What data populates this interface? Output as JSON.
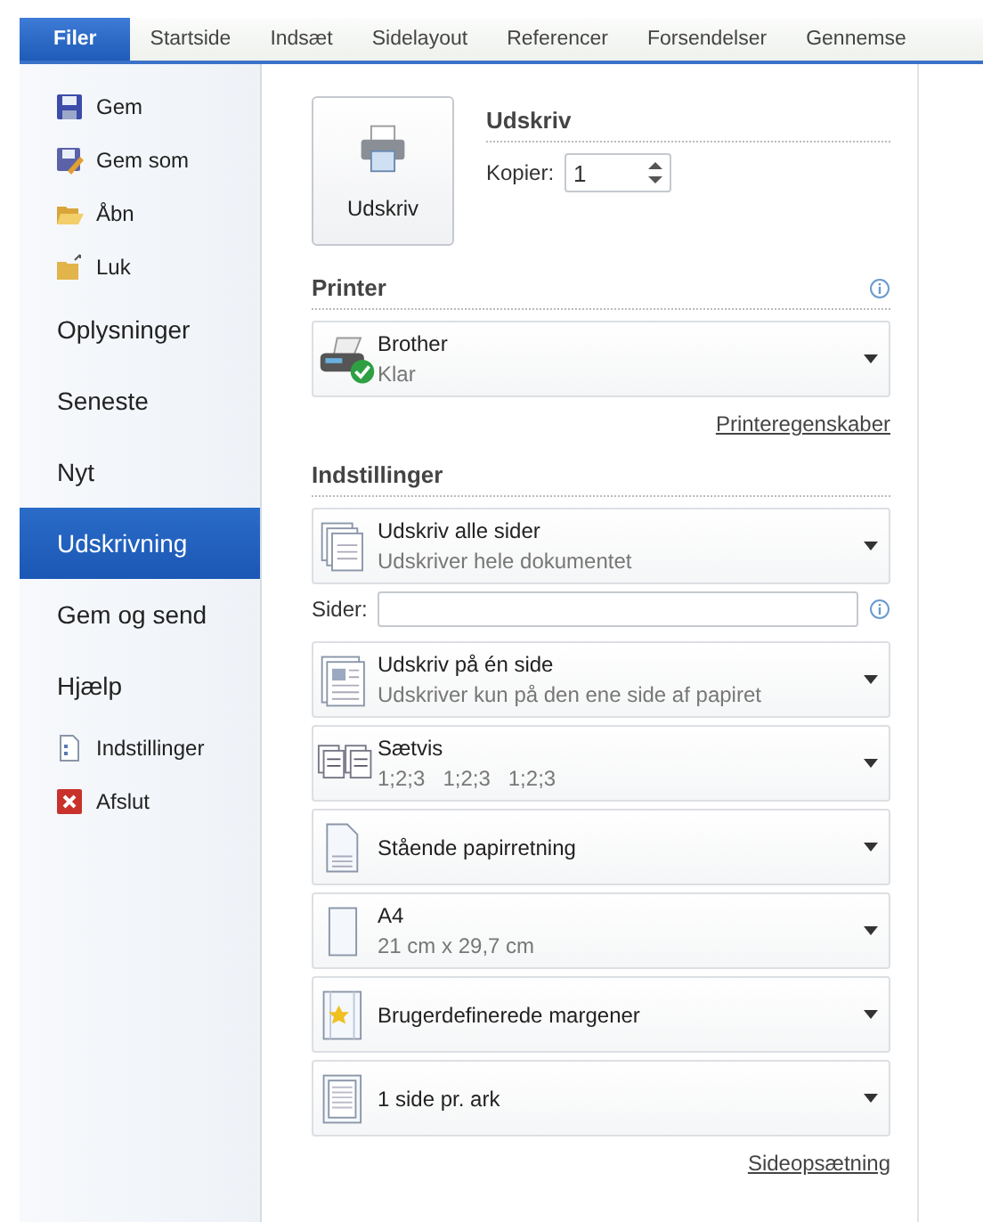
{
  "tabs": [
    {
      "label": "Filer",
      "selected": true
    },
    {
      "label": "Startside",
      "selected": false
    },
    {
      "label": "Indsæt",
      "selected": false
    },
    {
      "label": "Sidelayout",
      "selected": false
    },
    {
      "label": "Referencer",
      "selected": false
    },
    {
      "label": "Forsendelser",
      "selected": false
    },
    {
      "label": "Gennemse",
      "selected": false
    }
  ],
  "sidebar": {
    "items": [
      {
        "kind": "command",
        "label": "Gem",
        "selected": false
      },
      {
        "kind": "command",
        "label": "Gem som",
        "selected": false
      },
      {
        "kind": "command",
        "label": "Åbn",
        "selected": false
      },
      {
        "kind": "command",
        "label": "Luk",
        "selected": false
      },
      {
        "kind": "section",
        "label": "Oplysninger",
        "selected": false
      },
      {
        "kind": "section",
        "label": "Seneste",
        "selected": false
      },
      {
        "kind": "section",
        "label": "Nyt",
        "selected": false
      },
      {
        "kind": "section",
        "label": "Udskrivning",
        "selected": true
      },
      {
        "kind": "section",
        "label": "Gem og send",
        "selected": false
      },
      {
        "kind": "section",
        "label": "Hjælp",
        "selected": false
      },
      {
        "kind": "command",
        "label": "Indstillinger",
        "selected": false
      },
      {
        "kind": "command",
        "label": "Afslut",
        "selected": false
      }
    ]
  },
  "print": {
    "button": "Udskriv",
    "heading": "Udskriv",
    "copies_label": "Kopier:",
    "copies": "1"
  },
  "printer": {
    "heading": "Printer",
    "name": "Brother",
    "status": "Klar",
    "link": "Printeregenskaber"
  },
  "settings": {
    "heading": "Indstillinger",
    "pages_label": "Sider:",
    "link": "Sideopsætning",
    "options": [
      {
        "title": "Udskriv alle sider",
        "subtitle": "Udskriver hele dokumentet"
      },
      {
        "title": "Udskriv på én side",
        "subtitle": "Udskriver kun på den ene side af papiret"
      },
      {
        "title": "Sætvis",
        "subtitle": "1;2;3   1;2;3   1;2;3"
      },
      {
        "title": "Stående papirretning"
      },
      {
        "title": "A4",
        "subtitle": "21 cm x 29,7 cm"
      },
      {
        "title": "Brugerdefinerede margener"
      },
      {
        "title": "1 side pr. ark"
      }
    ]
  }
}
